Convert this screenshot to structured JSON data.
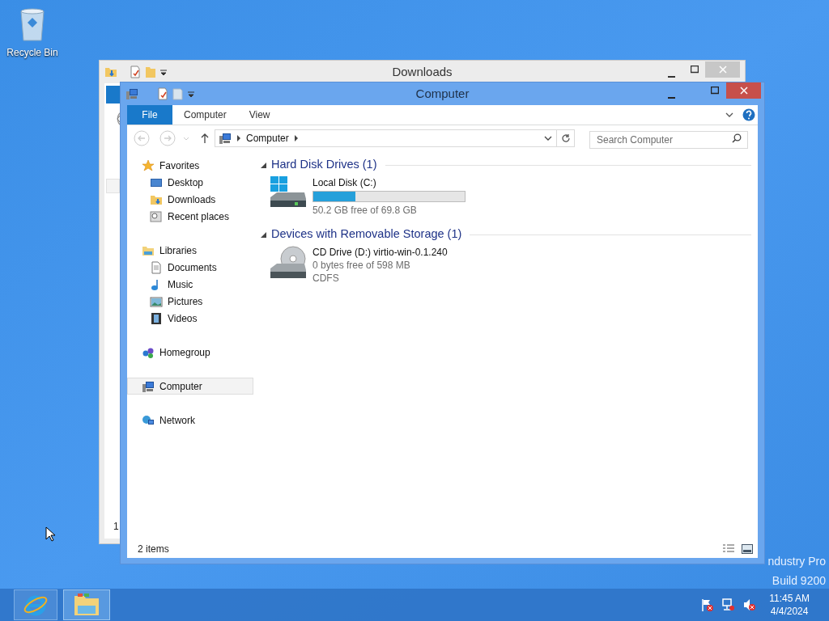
{
  "desktop_icons": [
    {
      "label": "Recycle Bin"
    }
  ],
  "back_window": {
    "title": "Downloads",
    "status_text": "1"
  },
  "window": {
    "title": "Computer",
    "ribbon_tabs": [
      {
        "label": "File",
        "selected": true
      },
      {
        "label": "Computer",
        "selected": false
      },
      {
        "label": "View",
        "selected": false
      }
    ],
    "address": {
      "crumbs": [
        "Computer"
      ]
    },
    "search": {
      "placeholder": "Search Computer"
    },
    "nav_pane": [
      {
        "label": "Favorites",
        "kind": "star",
        "selected": false,
        "children": [
          {
            "label": "Desktop",
            "kind": "desktop",
            "selected": false
          },
          {
            "label": "Downloads",
            "kind": "downloads",
            "selected": false
          },
          {
            "label": "Recent places",
            "kind": "recent",
            "selected": false
          }
        ]
      },
      {
        "label": "Libraries",
        "kind": "library",
        "selected": false,
        "children": [
          {
            "label": "Documents",
            "kind": "document",
            "selected": false
          },
          {
            "label": "Music",
            "kind": "music",
            "selected": false
          },
          {
            "label": "Pictures",
            "kind": "pictures",
            "selected": false
          },
          {
            "label": "Videos",
            "kind": "videos",
            "selected": false
          }
        ]
      },
      {
        "label": "Homegroup",
        "kind": "homegroup",
        "selected": false
      },
      {
        "label": "Computer",
        "kind": "computer",
        "selected": true
      },
      {
        "label": "Network",
        "kind": "network",
        "selected": false
      }
    ],
    "groups": [
      {
        "title": "Hard Disk Drives (1)",
        "items": [
          {
            "kind": "disk",
            "name": "Local Disk (C:)",
            "level": 0.28,
            "details": [
              "50.2 GB free of 69.8 GB"
            ]
          }
        ]
      },
      {
        "title": "Devices with Removable Storage (1)",
        "items": [
          {
            "kind": "cd",
            "name": "CD Drive (D:) virtio-win-0.1.240",
            "details": [
              "0 bytes free of 598 MB",
              "CDFS"
            ]
          }
        ]
      }
    ],
    "status_bar": "2 items"
  },
  "edition_text": [
    "ndustry Pro",
    "Build 9200"
  ],
  "taskbar": {
    "time": "11:45 AM",
    "date": "4/4/2024"
  }
}
